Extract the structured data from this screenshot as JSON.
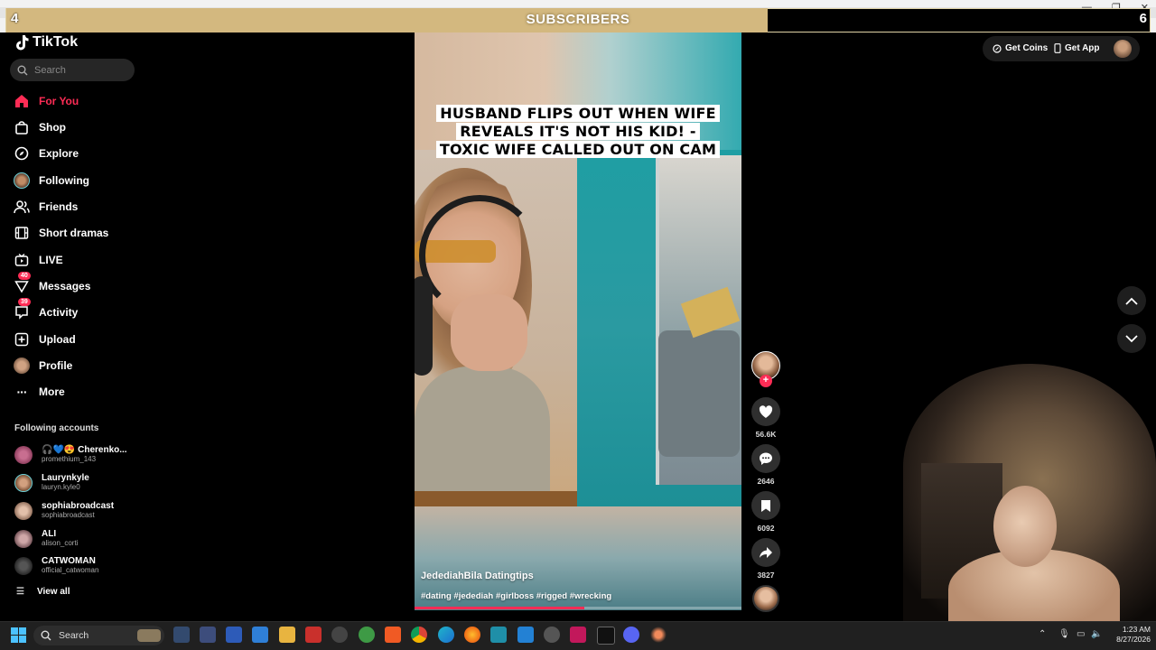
{
  "subscriber_bar": {
    "left_count": "4",
    "title": "SUBSCRIBERS",
    "right_count": "6"
  },
  "app": {
    "name": "TikTok"
  },
  "search": {
    "placeholder": "Search"
  },
  "nav": [
    {
      "label": "For You",
      "icon": "home-icon",
      "active": true
    },
    {
      "label": "Shop",
      "icon": "shopping-bag-icon"
    },
    {
      "label": "Explore",
      "icon": "compass-icon"
    },
    {
      "label": "Following",
      "icon": "following-avatar-icon"
    },
    {
      "label": "Friends",
      "icon": "friends-icon"
    },
    {
      "label": "Short dramas",
      "icon": "film-icon"
    },
    {
      "label": "LIVE",
      "icon": "live-tv-icon"
    },
    {
      "label": "Messages",
      "icon": "messages-icon",
      "badge": "40"
    },
    {
      "label": "Activity",
      "icon": "activity-icon",
      "badge": "39"
    },
    {
      "label": "Upload",
      "icon": "upload-plus-icon"
    },
    {
      "label": "Profile",
      "icon": "profile-avatar-icon"
    },
    {
      "label": "More",
      "icon": "more-dots-icon"
    }
  ],
  "following_accounts": {
    "title": "Following accounts",
    "items": [
      {
        "name": "🎧💙😍 Cherenko...",
        "handle": "promethium_143",
        "color": "#8a3a5a"
      },
      {
        "name": "Laurynkyle",
        "handle": "lauryn.kyle0",
        "color": "#b07a5b"
      },
      {
        "name": "sophiabroadcast",
        "handle": "sophiabroadcast",
        "color": "#c8a491"
      },
      {
        "name": "ALI",
        "handle": "alison_corti",
        "color": "#a07f80"
      },
      {
        "name": "CATWOMAN",
        "handle": "official_catwoman",
        "color": "#3a3a3a"
      }
    ],
    "view_all": "View all"
  },
  "video": {
    "headline": "HUSBAND FLIPS OUT WHEN WIFE REVEALS IT'S NOT HIS KID! - TOXIC WIFE CALLED OUT ON CAM",
    "author": "JedediahBila Datingtips",
    "tags": "#dating #jedediah #girlboss #rigged #wrecking",
    "progress": 0.52
  },
  "actions": {
    "likes": "56.6K",
    "comments": "2646",
    "saves": "6092",
    "shares": "3827"
  },
  "top_right": {
    "coins": "Get Coins",
    "app": "Get App"
  },
  "taskbar": {
    "search": "Search",
    "time": "1:23 AM",
    "date": "8/27/2026"
  }
}
